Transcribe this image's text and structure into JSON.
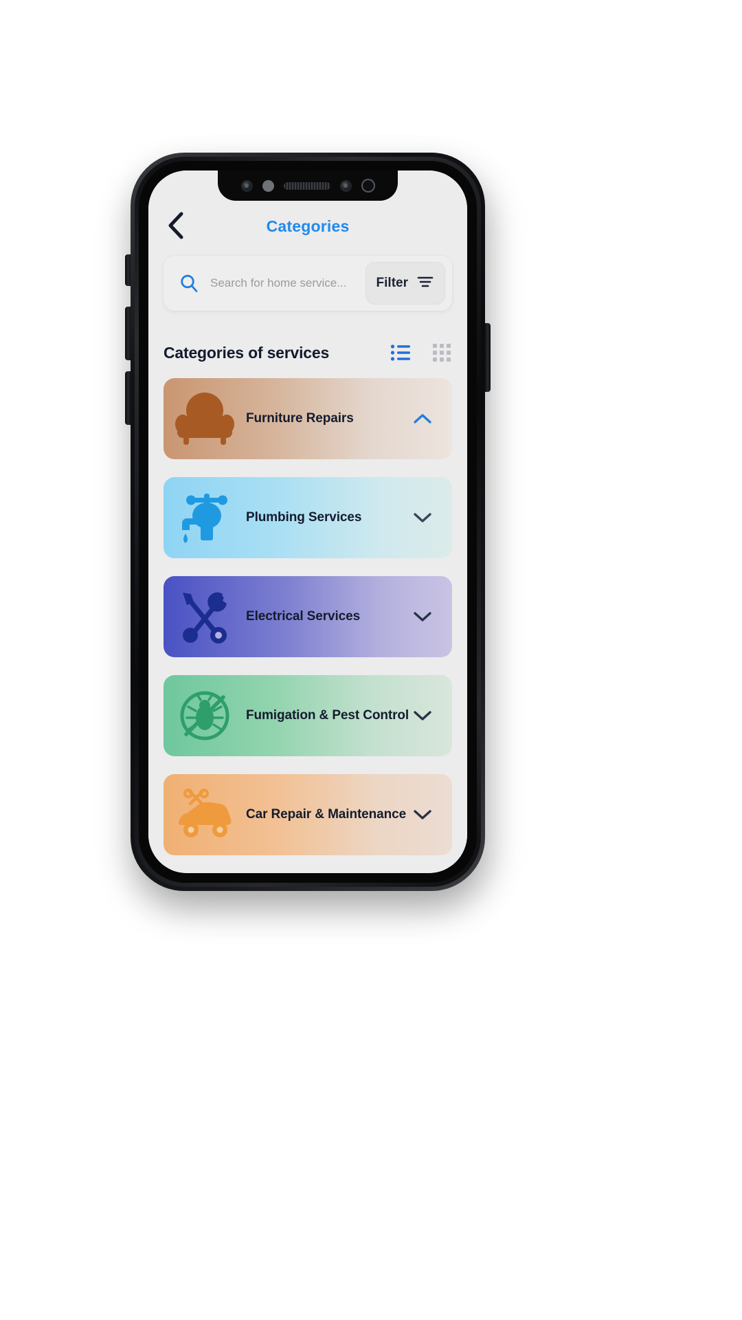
{
  "header": {
    "title": "Categories",
    "back_icon": "chevron-left-icon"
  },
  "search": {
    "placeholder": "Search for home service...",
    "value": "",
    "icon": "search-icon",
    "filter_label": "Filter",
    "filter_icon": "filter-lines-icon"
  },
  "section": {
    "title": "Categories of services",
    "list_view_icon": "list-view-icon",
    "grid_view_icon": "grid-view-icon",
    "active_view": "list"
  },
  "colors": {
    "accent_blue": "#1f8aee",
    "title_navy": "#121a2e",
    "screen_bg": "#ececec",
    "list_icon_active": "#1f6fd8",
    "grid_icon_inactive": "#b9bcc2"
  },
  "categories": [
    {
      "label": "Furniture  Repairs",
      "icon": "armchair-icon",
      "gradient_class": "g-furniture",
      "expanded": true,
      "chevron": "chevron-up-icon"
    },
    {
      "label": "Plumbing Services",
      "icon": "faucet-icon",
      "gradient_class": "g-plumbing",
      "expanded": false,
      "chevron": "chevron-down-icon"
    },
    {
      "label": "Electrical Services",
      "icon": "tools-wrench-screwdriver-icon",
      "gradient_class": "g-electric",
      "expanded": false,
      "chevron": "chevron-down-icon"
    },
    {
      "label": "Fumigation & Pest Control",
      "icon": "pest-control-bug-icon",
      "gradient_class": "g-pest",
      "expanded": false,
      "chevron": "chevron-down-icon"
    },
    {
      "label": "Car Repair & Maintenance",
      "icon": "car-repair-icon",
      "gradient_class": "g-car",
      "expanded": false,
      "chevron": "chevron-down-icon"
    }
  ]
}
